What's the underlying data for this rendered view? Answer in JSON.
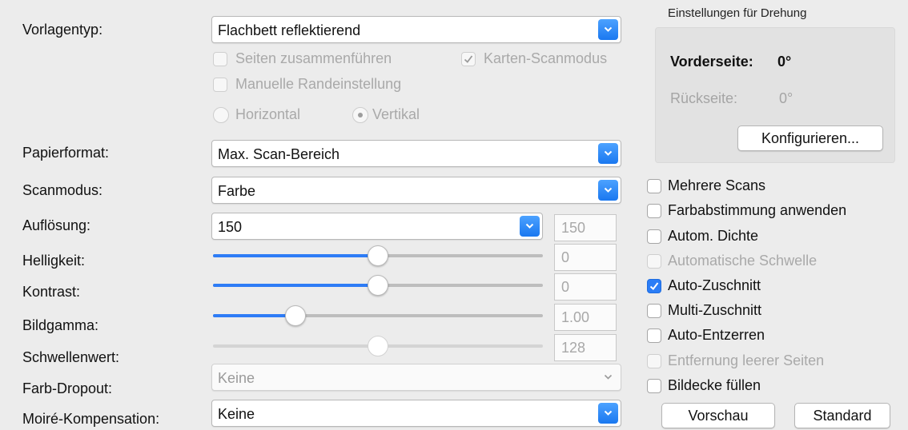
{
  "labels": {
    "vorlagentyp": "Vorlagentyp:",
    "papierformat": "Papierformat:",
    "scanmodus": "Scanmodus:",
    "aufloesung": "Auflösung:",
    "helligkeit": "Helligkeit:",
    "kontrast": "Kontrast:",
    "bildgamma": "Bildgamma:",
    "schwellenwert": "Schwellenwert:",
    "farb_dropout": "Farb-Dropout:",
    "moire": "Moiré-Kompensation:"
  },
  "selects": {
    "vorlagentyp": "Flachbett reflektierend",
    "papierformat": "Max. Scan-Bereich",
    "scanmodus": "Farbe",
    "aufloesung": "150",
    "farb_dropout": "Keine",
    "moire": "Keine"
  },
  "document_options": {
    "seiten_zusammenfuehren": "Seiten zusammenführen",
    "karten_scanmodus": "Karten-Scanmodus",
    "manuelle_randeinstellung": "Manuelle Randeinstellung",
    "horizontal": "Horizontal",
    "vertikal": "Vertikal"
  },
  "values": {
    "aufloesung": "150",
    "helligkeit": "0",
    "kontrast": "0",
    "bildgamma": "1.00",
    "schwellenwert": "128"
  },
  "slider_levels": {
    "helligkeit": 0.5,
    "kontrast": 0.5,
    "bildgamma": 0.25,
    "schwellenwert": 0.5
  },
  "rotation": {
    "title": "Einstellungen für Drehung",
    "vorderseite_label": "Vorderseite:",
    "vorderseite_value": "0°",
    "rueckseite_label": "Rückseite:",
    "rueckseite_value": "0°",
    "configure_button": "Konfigurieren..."
  },
  "checkboxes": {
    "mehrere_scans": "Mehrere Scans",
    "farbabstimmung": "Farbabstimmung anwenden",
    "autom_dichte": "Autom. Dichte",
    "automatische_schwelle": "Automatische Schwelle",
    "auto_zuschnitt": "Auto-Zuschnitt",
    "multi_zuschnitt": "Multi-Zuschnitt",
    "auto_entzerren": "Auto-Entzerren",
    "entfernung_leerer_seiten": "Entfernung leerer Seiten",
    "bildecke_fuellen": "Bildecke füllen"
  },
  "buttons": {
    "vorschau": "Vorschau",
    "standard": "Standard"
  },
  "colors": {
    "accent": "#2b7df6",
    "background": "#ececec",
    "disabled_text": "#a9a9a9"
  }
}
